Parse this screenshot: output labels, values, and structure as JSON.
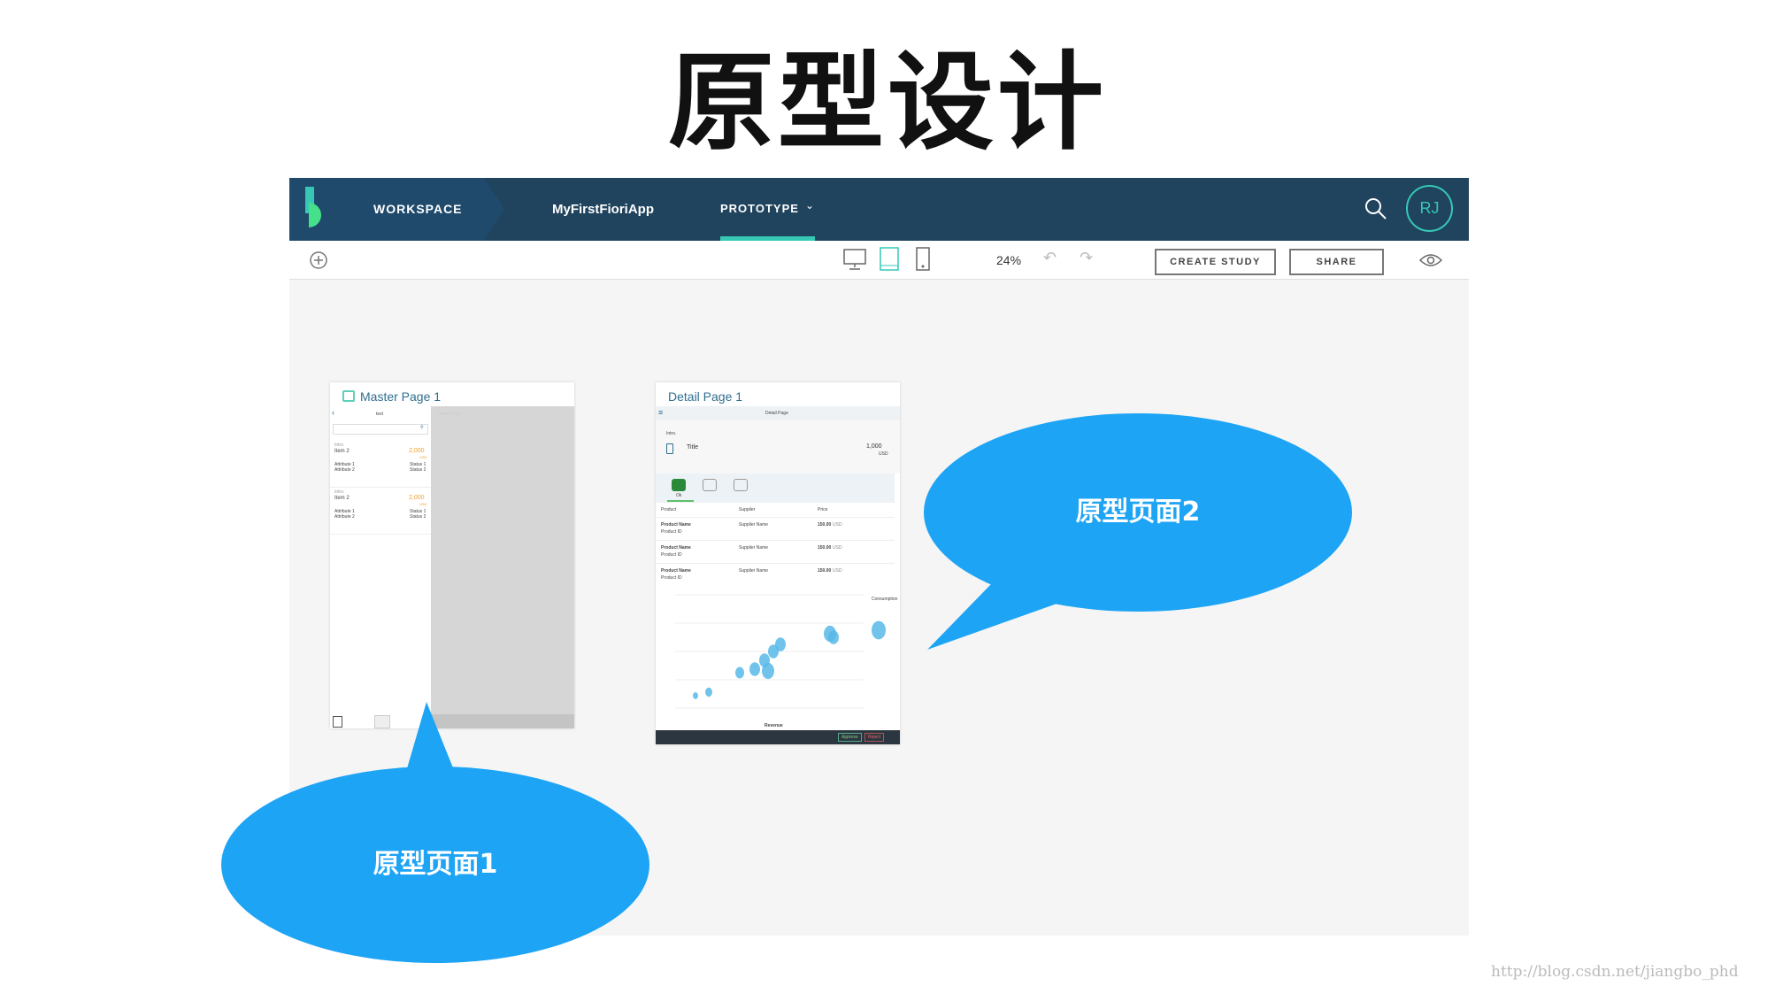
{
  "slide_title": "原型设计",
  "header": {
    "workspace": "WORKSPACE",
    "project": "MyFirstFioriApp",
    "prototype": "PROTOTYPE",
    "avatar": "RJ",
    "colors": {
      "bar": "#20435e",
      "accent": "#36c8b4"
    }
  },
  "toolbar": {
    "zoom": "24%",
    "create_study": "CREATE STUDY",
    "share": "SHARE",
    "active_device": "tablet"
  },
  "master": {
    "title": "Master Page 1",
    "nav_title": "text",
    "detail_ghost": "Detail Page",
    "items": [
      {
        "intro": "Intro.",
        "name": "Item 2",
        "amount": "2,000",
        "unit": "USD",
        "attr1": "Attribute 1",
        "attr2": "Attribute 2",
        "status1": "Status 1",
        "status2": "Status 2"
      },
      {
        "intro": "Intro.",
        "name": "Item 2",
        "amount": "2,000",
        "unit": "USD",
        "attr1": "Attribute 1",
        "attr2": "Attribute 2",
        "status1": "Status 1",
        "status2": "Status 2"
      }
    ]
  },
  "detail": {
    "title": "Detail Page 1",
    "nav_title": "Detail Page",
    "intro": "Intro.",
    "obj_title": "Title",
    "amount": "1,000",
    "unit": "USD",
    "tab_ok": "Ok",
    "columns": [
      "Product",
      "Supplier",
      "Price"
    ],
    "rows": [
      {
        "name": "Product Name",
        "id": "Product ID",
        "supplier": "Supplier Name",
        "price": "150.00",
        "unit": "USD"
      },
      {
        "name": "Product Name",
        "id": "Product ID",
        "supplier": "Supplier Name",
        "price": "150.00",
        "unit": "USD"
      },
      {
        "name": "Product Name",
        "id": "Product ID",
        "supplier": "Supplier Name",
        "price": "150.00",
        "unit": "USD"
      }
    ],
    "chart_xlabel": "Revenue",
    "chart_legend": "Consumption",
    "approve": "Approve",
    "reject": "Reject"
  },
  "callouts": {
    "one": "原型页面1",
    "two": "原型页面2",
    "color": "#1ea4f5"
  },
  "watermark": "http://blog.csdn.net/jiangbo_phd"
}
